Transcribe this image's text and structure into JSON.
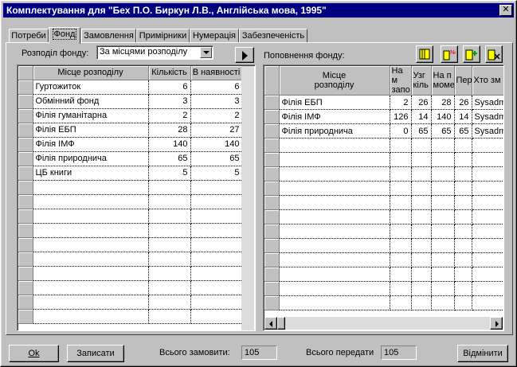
{
  "window": {
    "title": "Комплектування для \"Бех П.О. Биркун Л.В., Англійська мова, 1995\"",
    "close_symbol": "✕"
  },
  "tabs": [
    {
      "label": "Потреби"
    },
    {
      "label": "Фонд"
    },
    {
      "label": "Замовлення"
    },
    {
      "label": "Примірники"
    },
    {
      "label": "Нумерація"
    },
    {
      "label": "Забезпеченість"
    }
  ],
  "left": {
    "label": "Розподіл фонду:",
    "combo_value": "За місцями розподілу",
    "columns": [
      "Місце розподілу",
      "Кількість",
      "В наявності"
    ],
    "rows": [
      [
        "Гуртожиток",
        "6",
        "6"
      ],
      [
        "Обмінний фонд",
        "3",
        "3"
      ],
      [
        "Філія гуманітарна",
        "2",
        "2"
      ],
      [
        "Філія ЕБП",
        "28",
        "27"
      ],
      [
        "Філія ІМФ",
        "140",
        "140"
      ],
      [
        "Філія природнича",
        "65",
        "65"
      ],
      [
        "ЦБ книги",
        "5",
        "5"
      ]
    ]
  },
  "right": {
    "label": "Поповнення фонду:",
    "columns": [
      "Місце\nрозподілу",
      "На м\nзапо",
      "Узг\nкіль",
      "На п\nмоме",
      "Пер",
      "Хто зм"
    ],
    "rows": [
      [
        "Філія ЕБП",
        "2",
        "26",
        "28",
        "26",
        "Sysadm"
      ],
      [
        "Філія ІМФ",
        "126",
        "14",
        "140",
        "14",
        "Sysadm"
      ],
      [
        "Філія природнича",
        "0",
        "65",
        "65",
        "65",
        "Sysadm"
      ]
    ]
  },
  "footer": {
    "ok_label": "Ok",
    "save_label": "Записати",
    "total_order_label": "Всього замовити:",
    "total_order_value": "105",
    "total_transfer_label": "Всього передати",
    "total_transfer_value": "105",
    "cancel_label": "Відмінити"
  },
  "icons": [
    "book-icon",
    "number-book-icon",
    "add-book-icon",
    "remove-book-icon"
  ],
  "colors": {
    "titlebar": "#000080",
    "face": "#c0c0c0",
    "icon_yellow": "#ffff00",
    "icon_red": "#ff0000",
    "icon_green": "#00a000"
  }
}
